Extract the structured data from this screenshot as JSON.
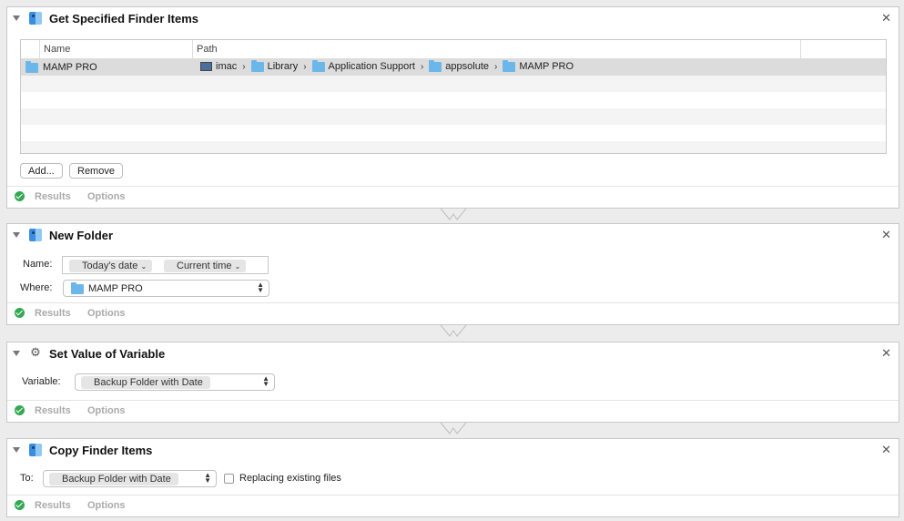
{
  "actions": [
    {
      "title": "Get Specified Finder Items",
      "table": {
        "columns": [
          "Name",
          "Path"
        ],
        "rows": [
          {
            "name": "MAMP PRO",
            "path": [
              "imac",
              "Library",
              "Application Support",
              "appsolute",
              "MAMP PRO"
            ]
          }
        ]
      },
      "buttons": {
        "add": "Add...",
        "remove": "Remove"
      }
    },
    {
      "title": "New Folder",
      "name_label": "Name:",
      "name_tokens": [
        "Today's date",
        "Current time"
      ],
      "where_label": "Where:",
      "where_value": "MAMP PRO"
    },
    {
      "title": "Set Value of Variable",
      "variable_label": "Variable:",
      "variable_value": "Backup Folder with Date"
    },
    {
      "title": "Copy Finder Items",
      "to_label": "To:",
      "to_value": "Backup Folder with Date",
      "replace_label": "Replacing existing files"
    }
  ],
  "footer": {
    "results": "Results",
    "options": "Options"
  },
  "icons": {
    "close": "close-icon",
    "disclosure": "disclosure-triangle-icon",
    "finder": "finder-icon",
    "variable": "variable-wand-icon",
    "status": "checkmark-circle-icon"
  },
  "colors": {
    "accent_folder": "#6cb7ea",
    "status_ok": "#34a853"
  }
}
